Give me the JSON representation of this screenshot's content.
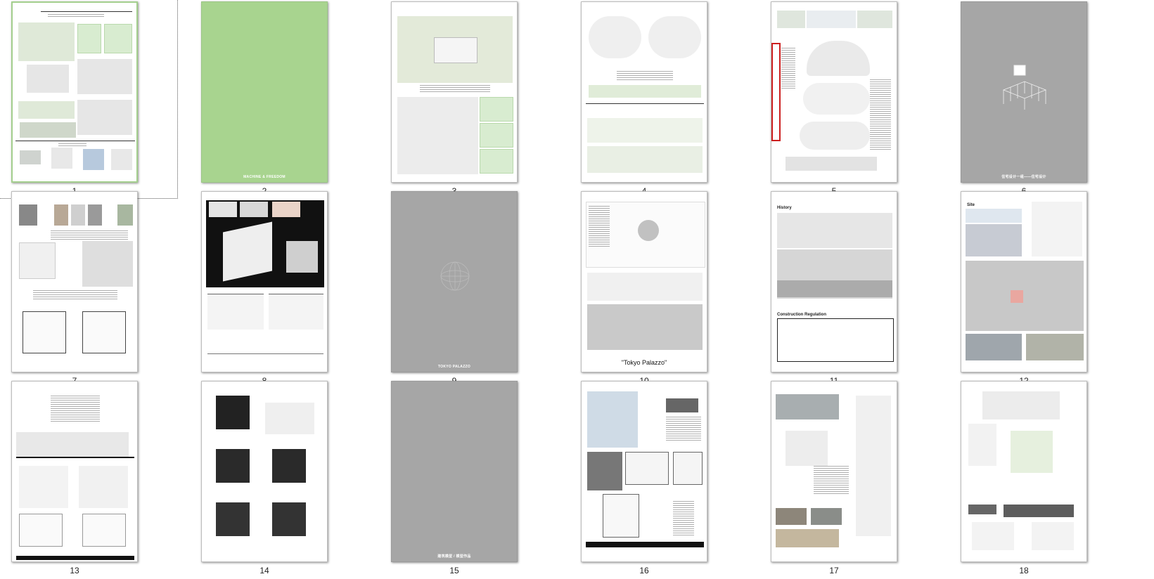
{
  "thumbnails": [
    {
      "num": "1",
      "kind": "board",
      "selected": true
    },
    {
      "num": "2",
      "kind": "green",
      "title": "MACHINE & FREEDOM"
    },
    {
      "num": "3",
      "kind": "plan"
    },
    {
      "num": "4",
      "kind": "sections"
    },
    {
      "num": "5",
      "kind": "exploded"
    },
    {
      "num": "6",
      "kind": "gray-model",
      "title": "住宅设计一组——住宅设计"
    },
    {
      "num": "7",
      "kind": "house"
    },
    {
      "num": "8",
      "kind": "model-photo"
    },
    {
      "num": "9",
      "kind": "gray-sphere",
      "title": "TOKYO PALAZZO"
    },
    {
      "num": "10",
      "kind": "map",
      "quote": "\"Tokyo Palazzo\""
    },
    {
      "num": "11",
      "kind": "history",
      "heading1": "History",
      "heading2": "Construction Regulation"
    },
    {
      "num": "12",
      "kind": "site",
      "heading1": "Site"
    },
    {
      "num": "13",
      "kind": "elevation"
    },
    {
      "num": "14",
      "kind": "plans"
    },
    {
      "num": "15",
      "kind": "gray",
      "title": "建筑模型 / 模型作品"
    },
    {
      "num": "16",
      "kind": "drawings"
    },
    {
      "num": "17",
      "kind": "renders"
    },
    {
      "num": "18",
      "kind": "axon"
    }
  ],
  "colors": {
    "green_page": "#a8d48f",
    "gray_page": "#a6a6a6",
    "selection_border": "#a4cf8e",
    "highlight_red": "#cc1f1f"
  }
}
